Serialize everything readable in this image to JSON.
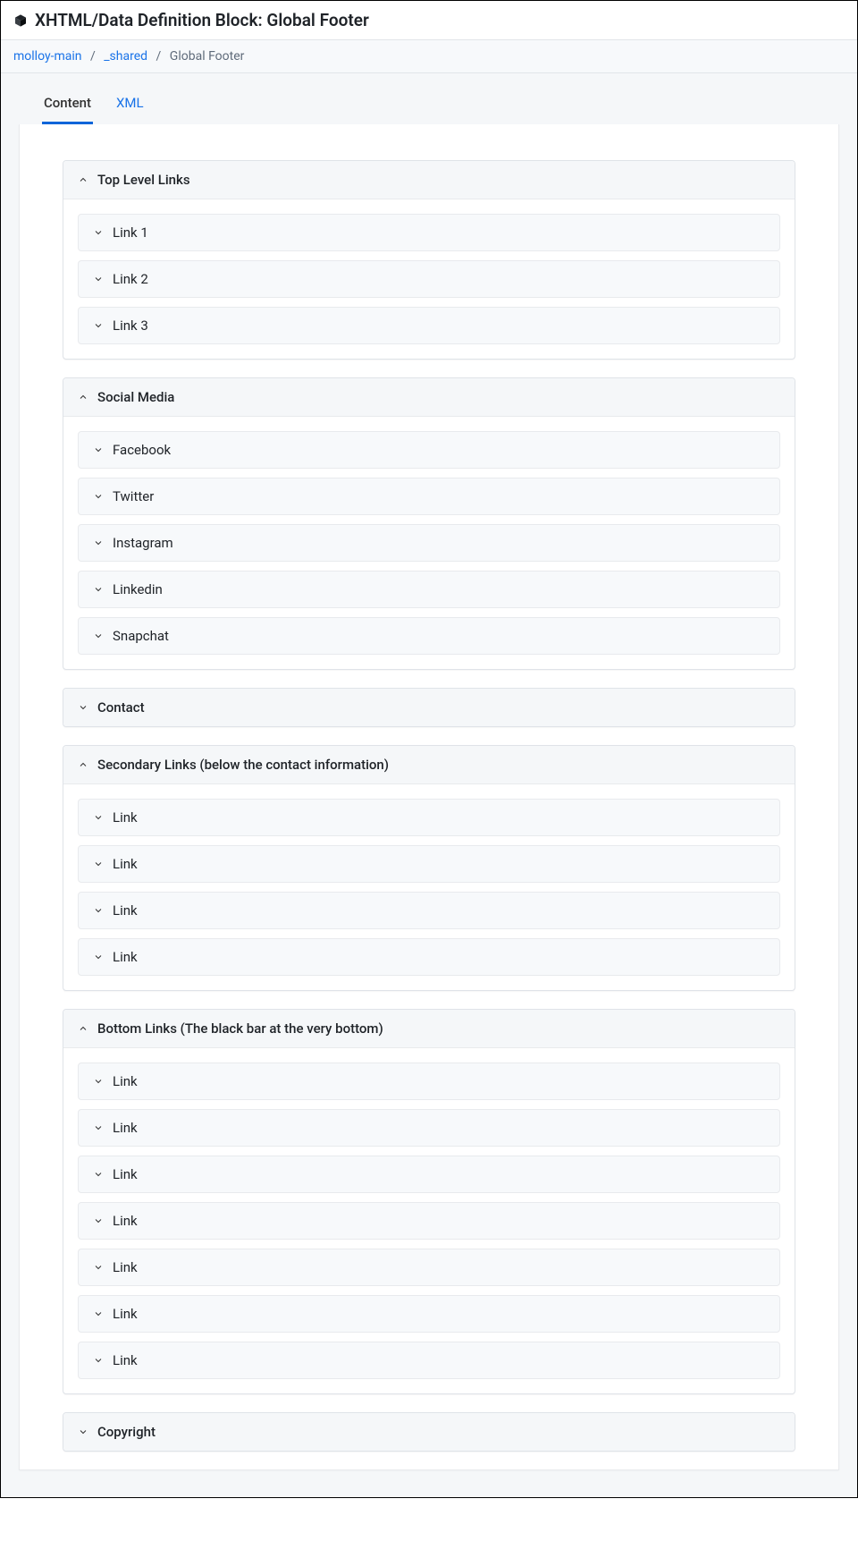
{
  "header": {
    "title": "XHTML/Data Definition Block: Global Footer"
  },
  "breadcrumb": {
    "items": [
      {
        "label": "molloy-main",
        "link": true
      },
      {
        "label": "_shared",
        "link": true
      },
      {
        "label": "Global Footer",
        "link": false
      }
    ]
  },
  "tabs": {
    "content": "Content",
    "xml": "XML"
  },
  "sections": {
    "topLevelLinks": {
      "title": "Top Level Links",
      "expanded": true,
      "items": [
        "Link 1",
        "Link 2",
        "Link 3"
      ]
    },
    "socialMedia": {
      "title": "Social Media",
      "expanded": true,
      "items": [
        "Facebook",
        "Twitter",
        "Instagram",
        "Linkedin",
        "Snapchat"
      ]
    },
    "contact": {
      "title": "Contact",
      "expanded": false,
      "items": []
    },
    "secondaryLinks": {
      "title": "Secondary Links (below the contact information)",
      "expanded": true,
      "items": [
        "Link",
        "Link",
        "Link",
        "Link"
      ]
    },
    "bottomLinks": {
      "title": "Bottom Links (The black bar at the very bottom)",
      "expanded": true,
      "items": [
        "Link",
        "Link",
        "Link",
        "Link",
        "Link",
        "Link",
        "Link"
      ]
    },
    "copyright": {
      "title": "Copyright",
      "expanded": false,
      "items": []
    }
  }
}
